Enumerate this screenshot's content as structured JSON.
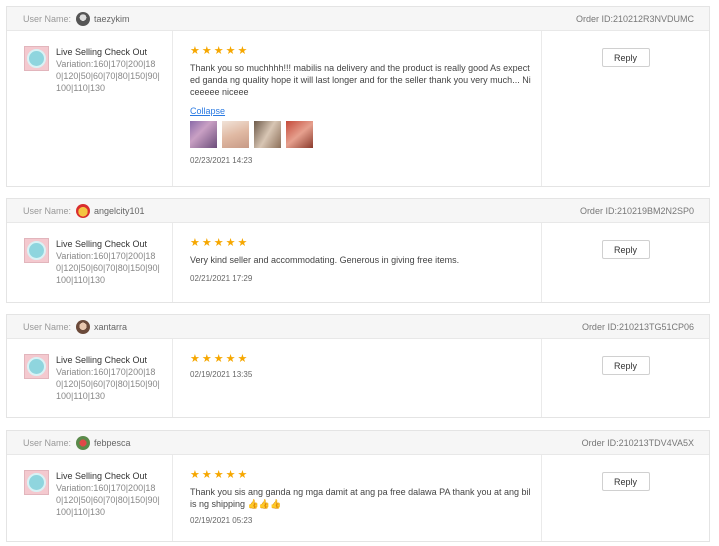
{
  "labels": {
    "user_name": "User Name:",
    "reply": "Reply",
    "collapse": "Collapse"
  },
  "colors": {
    "star": "#f6a700",
    "link": "#2a7ae2",
    "header_bg": "#f6f6f6"
  },
  "reviews": [
    {
      "username": "taezykim",
      "order_id": "Order ID:210212R3NVDUMC",
      "product_name": "Live Selling Check Out",
      "variation": "Variation:160|170|200|180|120|50|60|70|80|150|90|100|110|130",
      "rating": "★★★★★",
      "text": "Thank you so muchhhh!!! mabilis na delivery and the product is really good As expected ganda ng quality hope it will last longer and for the seller thank you very much... Niceeeee niceee",
      "date": "02/23/2021 14:23",
      "has_photos": true
    },
    {
      "username": "angelcity101",
      "order_id": "Order ID:210219BM2N2SP0",
      "product_name": "Live Selling Check Out",
      "variation": "Variation:160|170|200|180|120|50|60|70|80|150|90|100|110|130",
      "rating": "★★★★★",
      "text": "Very kind seller and accommodating. Generous in giving free items.",
      "date": "02/21/2021 17:29"
    },
    {
      "username": "xantarra",
      "order_id": "Order ID:210213TG51CP06",
      "product_name": "Live Selling Check Out",
      "variation": "Variation:160|170|200|180|120|50|60|70|80|150|90|100|110|130",
      "rating": "★★★★★",
      "text": "",
      "date": "02/19/2021 13:35"
    },
    {
      "username": "febpesca",
      "order_id": "Order ID:210213TDV4VA5X",
      "product_name": "Live Selling Check Out",
      "variation": "Variation:160|170|200|180|120|50|60|70|80|150|90|100|110|130",
      "rating": "★★★★★",
      "text": "Thank you sis ang ganda ng mga damit at ang pa free dalawa PA thank you at ang bilis ng shipping 👍👍👍",
      "date": "02/19/2021 05:23"
    }
  ]
}
